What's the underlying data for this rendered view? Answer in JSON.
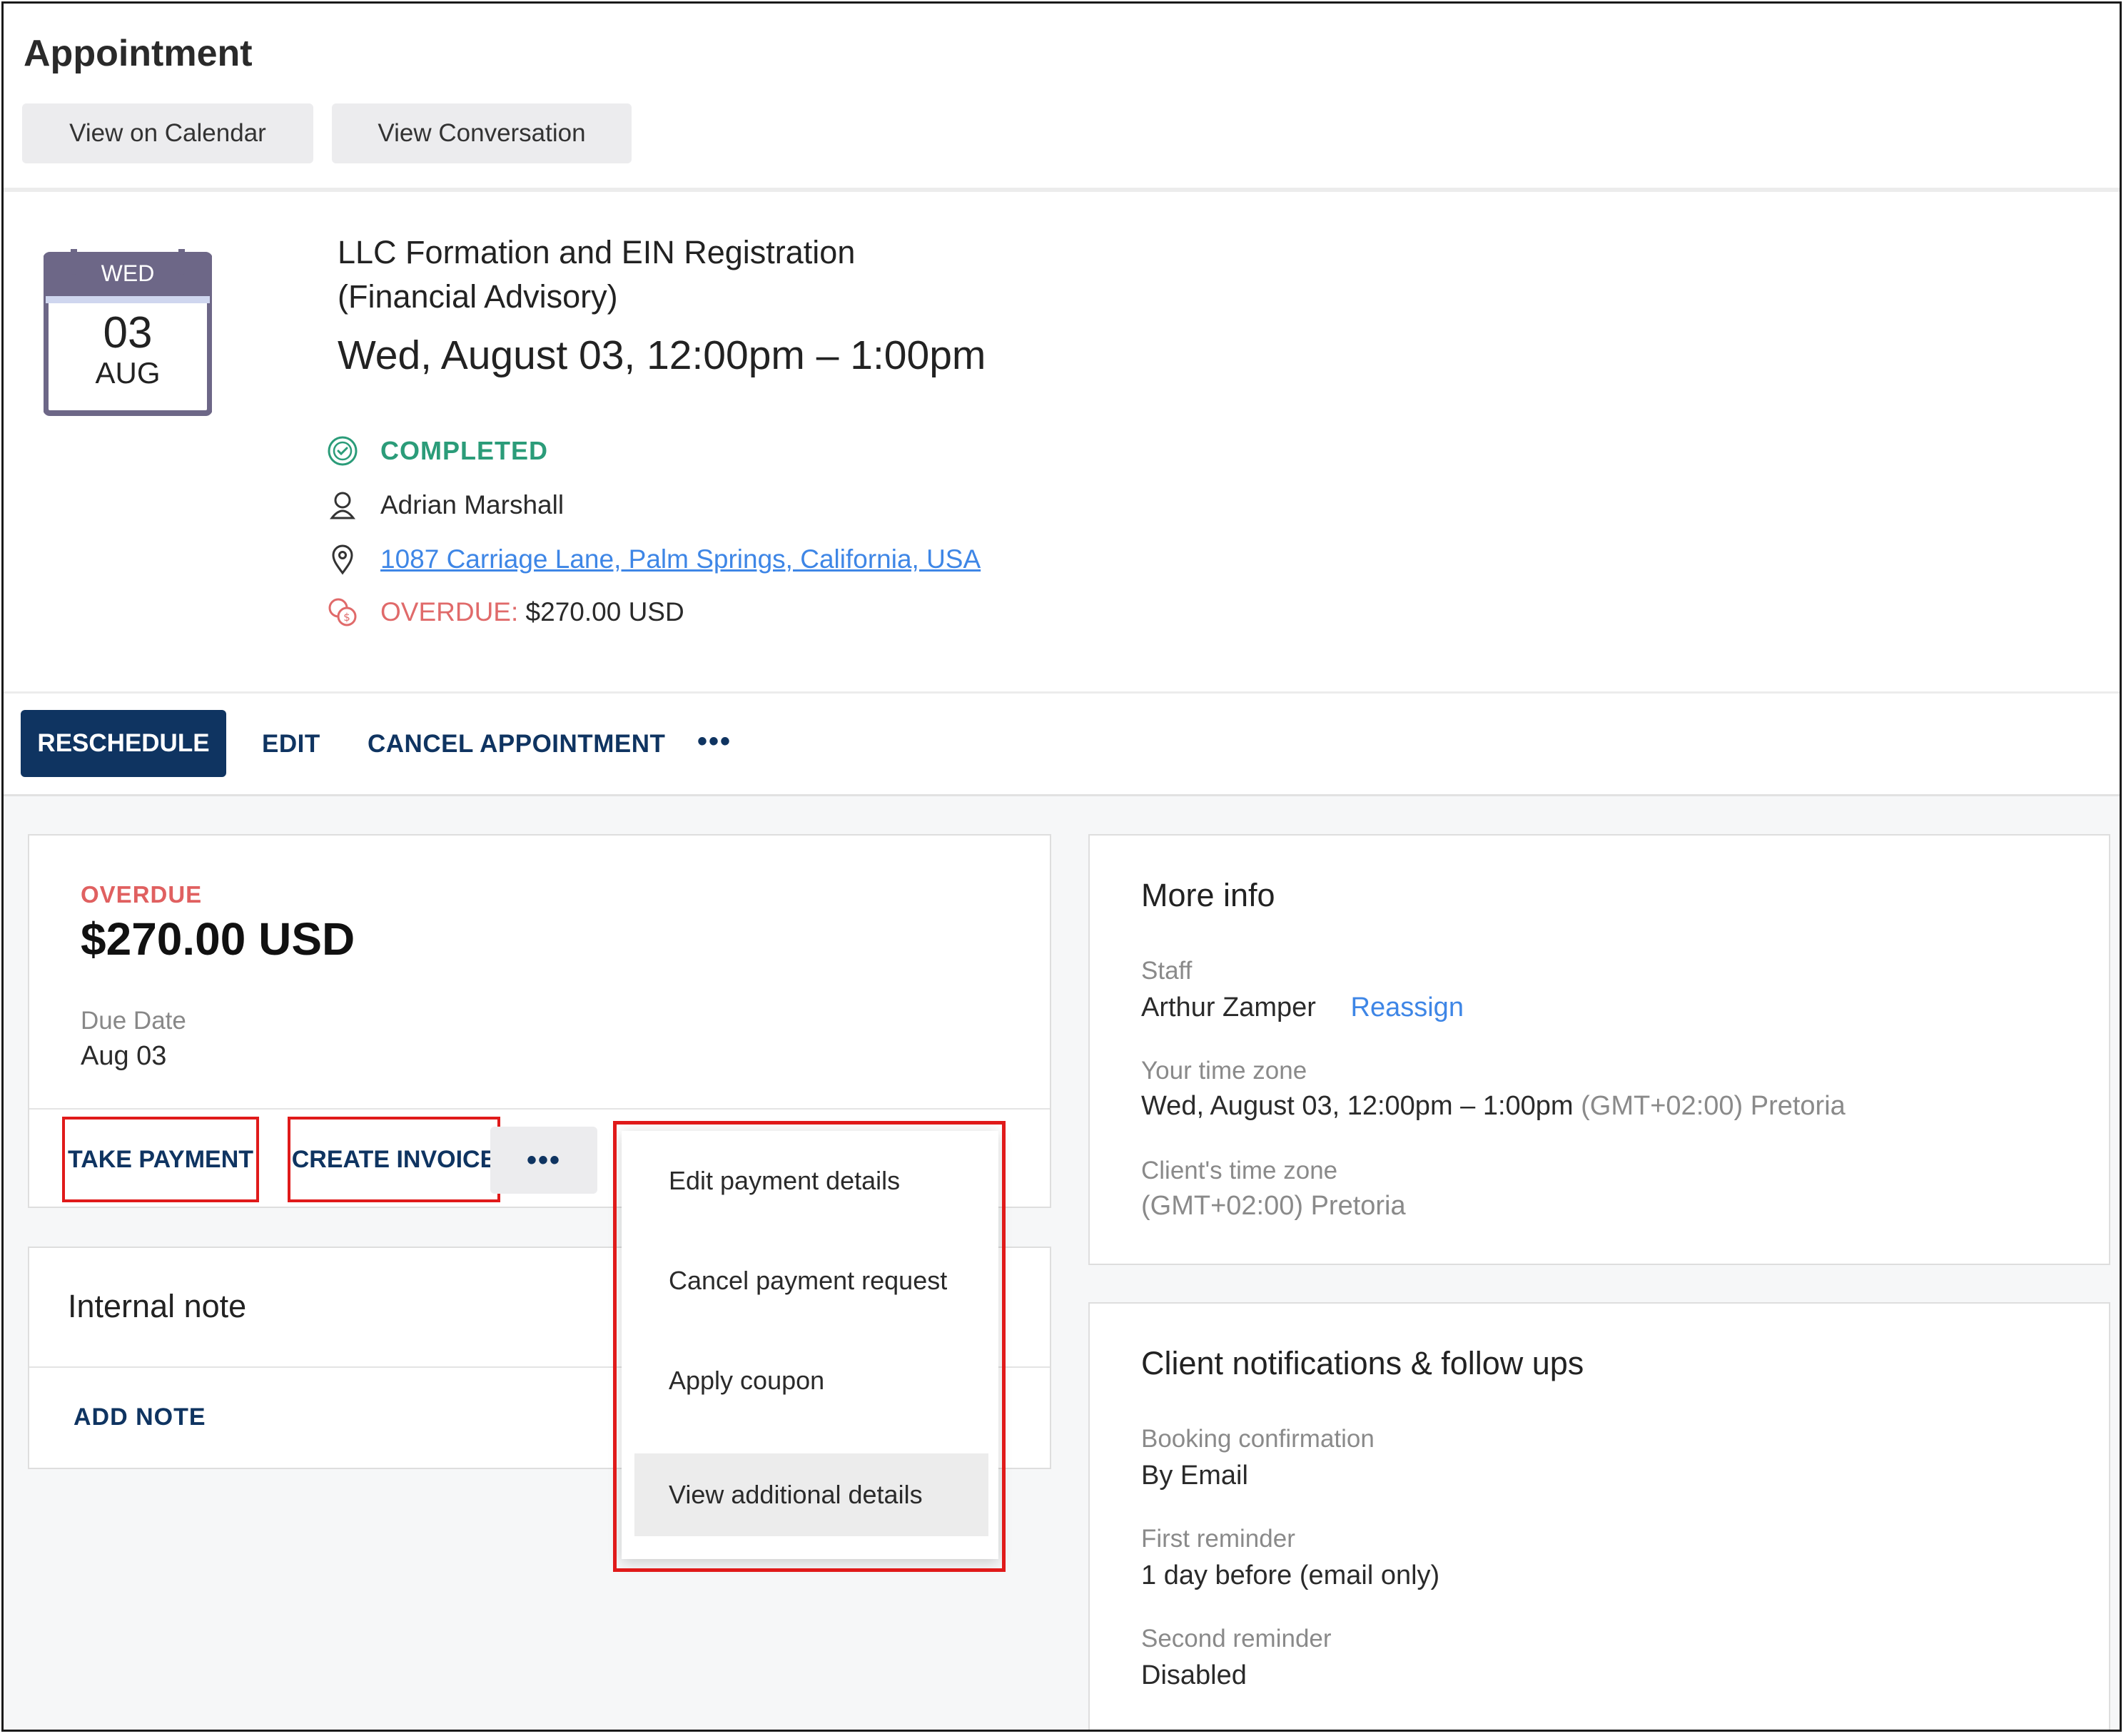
{
  "header": {
    "title": "Appointment",
    "view_calendar": "View on Calendar",
    "view_conversation": "View Conversation"
  },
  "calendar_icon": {
    "weekday": "WED",
    "day": "03",
    "month": "AUG"
  },
  "appointment": {
    "title_line1": "LLC Formation and EIN Registration",
    "title_line2": "(Financial Advisory)",
    "time": "Wed, August 03, 12:00pm – 1:00pm",
    "status": "COMPLETED",
    "client": "Adrian Marshall",
    "address": "1087 Carriage Lane, Palm Springs, California, USA",
    "overdue_label": "OVERDUE:",
    "overdue_amount": "$270.00 USD"
  },
  "actions": {
    "reschedule": "RESCHEDULE",
    "edit": "EDIT",
    "cancel": "CANCEL APPOINTMENT",
    "more": "•••"
  },
  "payment": {
    "status": "OVERDUE",
    "amount": "$270.00 USD",
    "due_label": "Due Date",
    "due_value": "Aug 03",
    "take_payment": "TAKE PAYMENT",
    "create_invoice": "CREATE INVOICE",
    "more": "•••"
  },
  "payment_menu": {
    "items": [
      "Edit payment details",
      "Cancel payment request",
      "Apply coupon",
      "View additional details"
    ]
  },
  "note": {
    "title": "Internal note",
    "add": "ADD NOTE"
  },
  "more_info": {
    "title": "More info",
    "staff_label": "Staff",
    "staff_value": "Arthur Zamper",
    "reassign": "Reassign",
    "tz_label": "Your time zone",
    "tz_value": "Wed, August 03, 12:00pm – 1:00pm",
    "tz_suffix": "(GMT+02:00) Pretoria",
    "client_tz_label": "Client's time zone",
    "client_tz_value": "(GMT+02:00) Pretoria"
  },
  "notifications": {
    "title": "Client notifications & follow ups",
    "booking_label": "Booking confirmation",
    "booking_value": "By Email",
    "first_label": "First reminder",
    "first_value": "1 day before (email only)",
    "second_label": "Second reminder",
    "second_value": "Disabled"
  },
  "colors": {
    "primary": "#0f3461",
    "completed": "#2b9c79",
    "overdue": "#e06060",
    "link": "#3e86e6",
    "highlight_box": "#e01a1a"
  }
}
